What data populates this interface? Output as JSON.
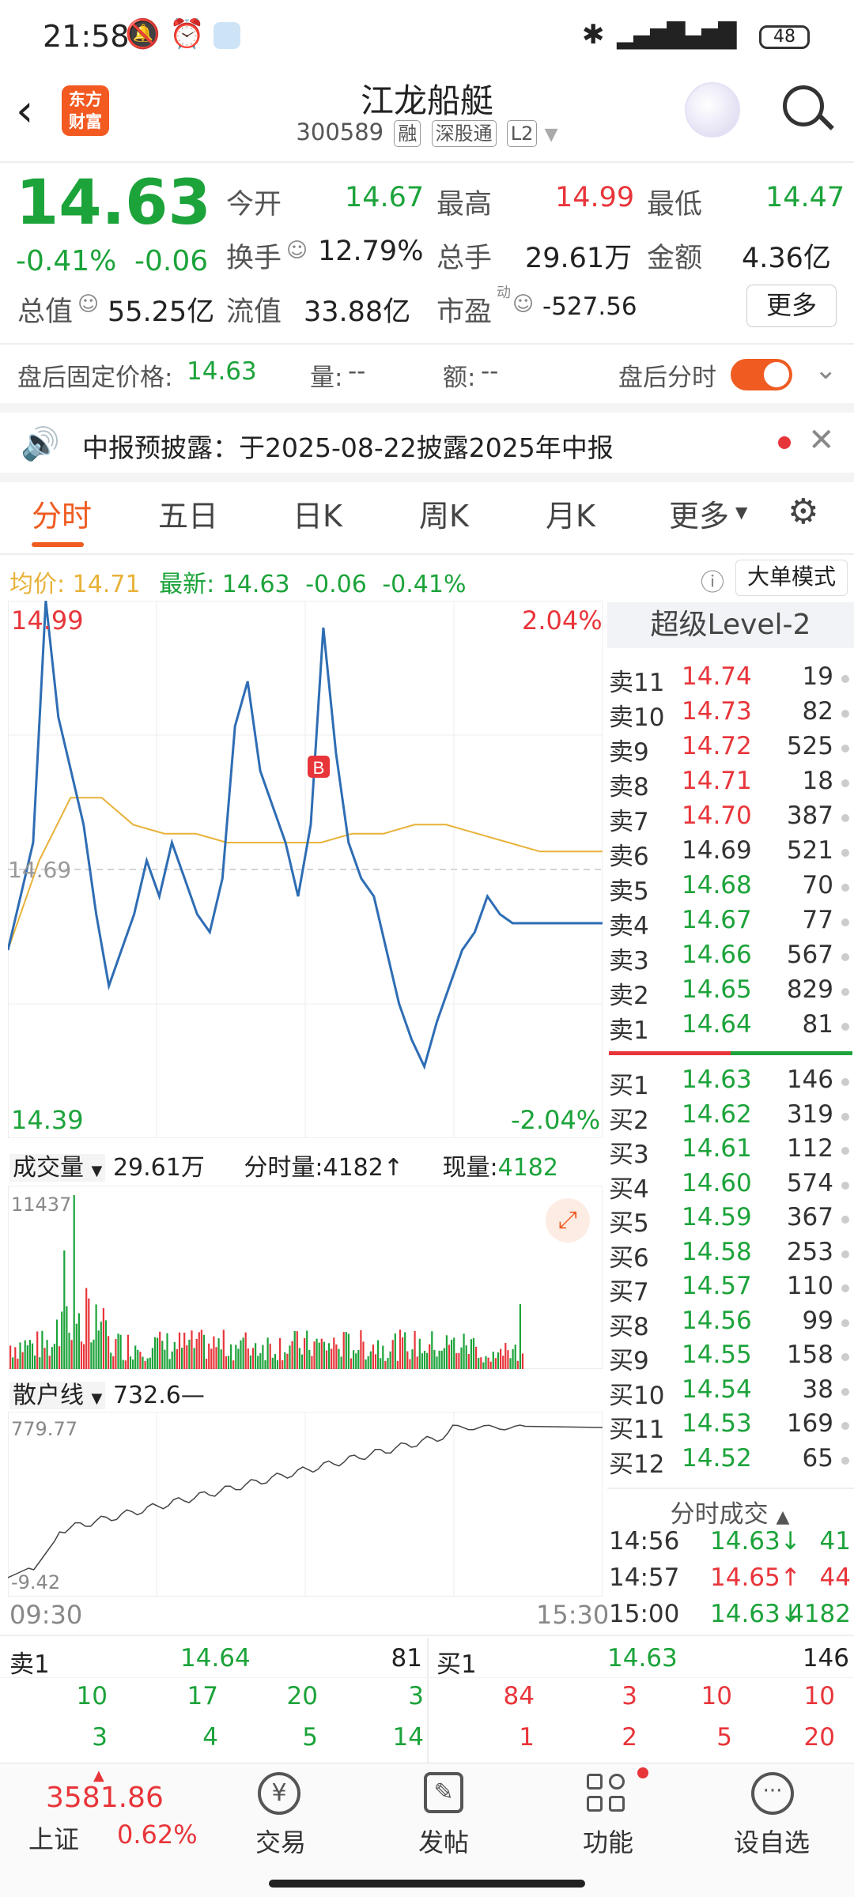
{
  "status": {
    "time": "21:58",
    "battery": "48"
  },
  "header": {
    "logo_line1": "东方",
    "logo_line2": "财富",
    "title": "江龙船艇",
    "code": "300589",
    "tag1": "融",
    "tag2": "深股通",
    "tag3": "L2"
  },
  "quote": {
    "price": "14.63",
    "change_pct": "-0.41%",
    "change": "-0.06",
    "open_label": "今开",
    "open": "14.67",
    "high_label": "最高",
    "high": "14.99",
    "low_label": "最低",
    "low": "14.47",
    "turnover_label": "换手",
    "turnover": "12.79%",
    "volume_label": "总手",
    "volume": "29.61万",
    "amount_label": "金额",
    "amount": "4.36亿",
    "mktcap_label": "总值",
    "mktcap": "55.25亿",
    "float_label": "流值",
    "float_cap": "33.88亿",
    "pe_label": "市盈",
    "pe_sup": "动",
    "pe": "-527.56",
    "more_button": "更多"
  },
  "after_hours": {
    "label": "盘后固定价格:",
    "price": "14.63",
    "vol_label": "量:",
    "vol": "--",
    "amt_label": "额:",
    "amt": "--",
    "toggle_label": "盘后分时"
  },
  "notice": {
    "text": "中报预披露：于2025-08-22披露2025年中报"
  },
  "tabs": [
    "分时",
    "五日",
    "日K",
    "周K",
    "月K",
    "更多"
  ],
  "info_line": {
    "avg_label": "均价:",
    "avg": "14.71",
    "latest_label": "最新:",
    "latest": "14.63",
    "chg": "-0.06",
    "pct": "-0.41%",
    "mode_button": "大单模式"
  },
  "chart": {
    "top_price": "14.99",
    "top_pct": "2.04%",
    "mid_price": "14.69",
    "bottom_price": "14.39",
    "bottom_pct": "-2.04%",
    "marker": "B",
    "vol_selector": "成交量",
    "vol_total": "29.61万",
    "period_vol_label": "分时量:",
    "period_vol": "4182↑",
    "now_vol_label": "现量:",
    "now_vol": "4182",
    "vol_max": "11437",
    "retail_selector": "散户线",
    "retail_val": "732.6—",
    "retail_max": "779.77",
    "retail_min": "-9.42",
    "time_start": "09:30",
    "time_end": "15:30"
  },
  "chart_data": {
    "type": "line",
    "price_series": [
      14.6,
      14.66,
      14.72,
      14.99,
      14.86,
      14.8,
      14.74,
      14.64,
      14.56,
      14.6,
      14.64,
      14.7,
      14.66,
      14.72,
      14.68,
      14.64,
      14.62,
      14.68,
      14.85,
      14.9,
      14.8,
      14.76,
      14.72,
      14.66,
      14.74,
      14.96,
      14.82,
      14.72,
      14.68,
      14.66,
      14.6,
      14.54,
      14.5,
      14.47,
      14.52,
      14.56,
      14.6,
      14.62,
      14.66,
      14.64,
      14.63,
      14.63
    ],
    "avg_series": [
      14.6,
      14.7,
      14.77,
      14.77,
      14.74,
      14.73,
      14.73,
      14.72,
      14.72,
      14.72,
      14.72,
      14.73,
      14.73,
      14.74,
      14.74,
      14.73,
      14.72,
      14.71,
      14.71,
      14.71
    ],
    "ylim": [
      14.39,
      14.99
    ]
  },
  "orderbook": {
    "title": "超级Level-2",
    "sells": [
      {
        "label": "卖11",
        "price": "14.74",
        "vol": "19"
      },
      {
        "label": "卖10",
        "price": "14.73",
        "vol": "82"
      },
      {
        "label": "卖9",
        "price": "14.72",
        "vol": "525"
      },
      {
        "label": "卖8",
        "price": "14.71",
        "vol": "18"
      },
      {
        "label": "卖7",
        "price": "14.70",
        "vol": "387"
      },
      {
        "label": "卖6",
        "price": "14.69",
        "vol": "521"
      },
      {
        "label": "卖5",
        "price": "14.68",
        "vol": "70"
      },
      {
        "label": "卖4",
        "price": "14.67",
        "vol": "77"
      },
      {
        "label": "卖3",
        "price": "14.66",
        "vol": "567"
      },
      {
        "label": "卖2",
        "price": "14.65",
        "vol": "829"
      },
      {
        "label": "卖1",
        "price": "14.64",
        "vol": "81"
      }
    ],
    "buys": [
      {
        "label": "买1",
        "price": "14.63",
        "vol": "146"
      },
      {
        "label": "买2",
        "price": "14.62",
        "vol": "319"
      },
      {
        "label": "买3",
        "price": "14.61",
        "vol": "112"
      },
      {
        "label": "买4",
        "price": "14.60",
        "vol": "574"
      },
      {
        "label": "买5",
        "price": "14.59",
        "vol": "367"
      },
      {
        "label": "买6",
        "price": "14.58",
        "vol": "253"
      },
      {
        "label": "买7",
        "price": "14.57",
        "vol": "110"
      },
      {
        "label": "买8",
        "price": "14.56",
        "vol": "99"
      },
      {
        "label": "买9",
        "price": "14.55",
        "vol": "158"
      },
      {
        "label": "买10",
        "price": "14.54",
        "vol": "38"
      },
      {
        "label": "买11",
        "price": "14.53",
        "vol": "169"
      },
      {
        "label": "买12",
        "price": "14.52",
        "vol": "65"
      }
    ],
    "ticks_title": "分时成交",
    "ticks": [
      {
        "time": "14:56",
        "price": "14.63↓",
        "vol": "41"
      },
      {
        "time": "14:57",
        "price": "14.65↑",
        "vol": "44"
      },
      {
        "time": "15:00",
        "price": "14.63↓",
        "vol": "4182"
      }
    ]
  },
  "bottom_queue": {
    "sell_label": "卖1",
    "sell_price": "14.64",
    "sell_vol": "81",
    "buy_label": "买1",
    "buy_price": "14.63",
    "buy_vol": "146",
    "sell_row1": [
      "10",
      "17",
      "20",
      "3"
    ],
    "sell_row2": [
      "3",
      "4",
      "5",
      "14"
    ],
    "buy_row1": [
      "84",
      "3",
      "10",
      "10"
    ],
    "buy_row2": [
      "1",
      "2",
      "5",
      "20"
    ]
  },
  "navbar": {
    "index_value": "3581.86",
    "index_name": "上证",
    "index_pct": "0.62%",
    "trade": "交易",
    "post": "发帖",
    "functions": "功能",
    "watchlist": "设自选"
  },
  "colors": {
    "accent": "#ef5b20",
    "up": "#e8353a",
    "down": "#1ca33a",
    "line": "#2e6db4",
    "avg": "#e8b23a"
  }
}
